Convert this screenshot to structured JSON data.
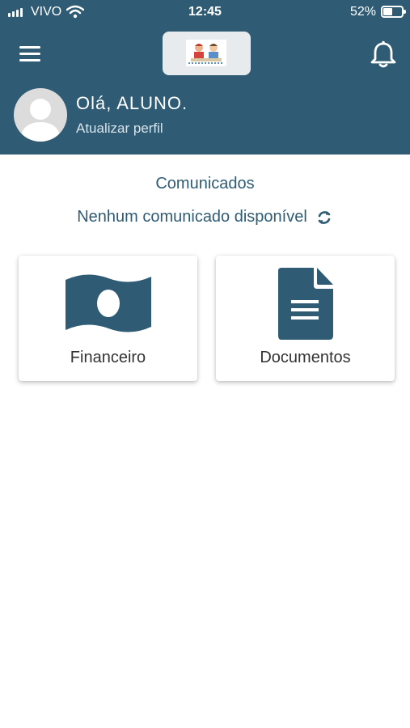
{
  "status_bar": {
    "carrier": "VIVO",
    "time": "12:45",
    "battery_pct": "52%",
    "battery_level": 0.52
  },
  "header": {
    "greeting": "Olá, ALUNO.",
    "update_profile": "Atualizar perfil"
  },
  "main": {
    "section_title": "Comunicados",
    "no_messages": "Nenhum comunicado disponível",
    "cards": [
      {
        "label": "Financeiro"
      },
      {
        "label": "Documentos"
      }
    ]
  },
  "colors": {
    "primary": "#2f5c74",
    "background": "#ffffff",
    "card_text": "#333333"
  },
  "icons": [
    "signal-icon",
    "wifi-icon",
    "battery-icon",
    "menu-icon",
    "school-logo",
    "bell-icon",
    "avatar-icon",
    "refresh-icon",
    "money-icon",
    "document-icon"
  ]
}
